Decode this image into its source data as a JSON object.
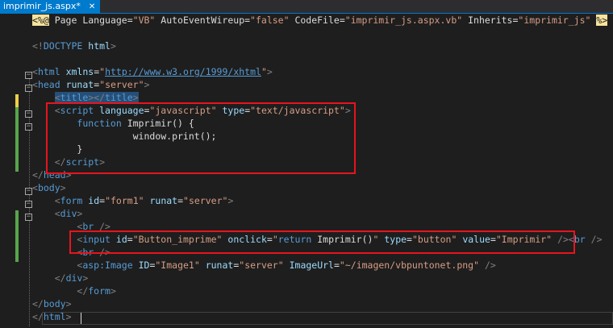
{
  "tab": {
    "title": "imprimir_js.aspx*",
    "close": "✕"
  },
  "lines": [
    {
      "id": "l1",
      "tokens": [
        {
          "c": "dir",
          "t": "<%@"
        },
        {
          "c": "text",
          "t": " Page Language="
        },
        {
          "c": "str",
          "t": "\"VB\""
        },
        {
          "c": "text",
          "t": " AutoEventWireup="
        },
        {
          "c": "str",
          "t": "\"false\""
        },
        {
          "c": "text",
          "t": " CodeFile="
        },
        {
          "c": "str",
          "t": "\"imprimir_js.aspx.vb\""
        },
        {
          "c": "text",
          "t": " Inherits="
        },
        {
          "c": "str",
          "t": "\"imprimir_js\""
        },
        {
          "c": "text",
          "t": " "
        },
        {
          "c": "dir",
          "t": "%>"
        }
      ]
    },
    {
      "id": "l2",
      "tokens": []
    },
    {
      "id": "l3",
      "tokens": [
        {
          "c": "bracket",
          "t": "<!"
        },
        {
          "c": "doctype",
          "t": "DOCTYPE"
        },
        {
          "c": "text",
          "t": " "
        },
        {
          "c": "attr",
          "t": "html"
        },
        {
          "c": "bracket",
          "t": ">"
        }
      ]
    },
    {
      "id": "l4",
      "tokens": []
    },
    {
      "id": "l5",
      "tokens": [
        {
          "c": "bracket",
          "t": "<"
        },
        {
          "c": "tag",
          "t": "html"
        },
        {
          "c": "text",
          "t": " "
        },
        {
          "c": "attr",
          "t": "xmlns"
        },
        {
          "c": "text",
          "t": "="
        },
        {
          "c": "str",
          "t": "\""
        },
        {
          "c": "url",
          "t": "http://www.w3.org/1999/xhtml"
        },
        {
          "c": "str",
          "t": "\""
        },
        {
          "c": "bracket",
          "t": ">"
        }
      ]
    },
    {
      "id": "l6",
      "tokens": [
        {
          "c": "bracket",
          "t": "<"
        },
        {
          "c": "tag",
          "t": "head"
        },
        {
          "c": "text",
          "t": " "
        },
        {
          "c": "attr",
          "t": "runat"
        },
        {
          "c": "text",
          "t": "="
        },
        {
          "c": "str",
          "t": "\"server\""
        },
        {
          "c": "bracket",
          "t": ">"
        }
      ]
    },
    {
      "id": "l7",
      "tokens": [
        {
          "c": "text",
          "t": "    "
        },
        {
          "c": "bracket sel",
          "t": "<"
        },
        {
          "c": "tag sel",
          "t": "title"
        },
        {
          "c": "bracket sel",
          "t": "></"
        },
        {
          "c": "tag sel",
          "t": "title"
        },
        {
          "c": "bracket sel",
          "t": ">"
        }
      ]
    },
    {
      "id": "l8",
      "tokens": [
        {
          "c": "text",
          "t": "    "
        },
        {
          "c": "bracket",
          "t": "<"
        },
        {
          "c": "tag",
          "t": "script"
        },
        {
          "c": "text",
          "t": " "
        },
        {
          "c": "attr",
          "t": "language"
        },
        {
          "c": "text",
          "t": "="
        },
        {
          "c": "str",
          "t": "\"javascript\""
        },
        {
          "c": "text",
          "t": " "
        },
        {
          "c": "attr",
          "t": "type"
        },
        {
          "c": "text",
          "t": "="
        },
        {
          "c": "str",
          "t": "\"text/javascript\""
        },
        {
          "c": "bracket",
          "t": ">"
        }
      ]
    },
    {
      "id": "l9",
      "tokens": [
        {
          "c": "text",
          "t": "        "
        },
        {
          "c": "kw",
          "t": "function"
        },
        {
          "c": "fn",
          "t": " Imprimir() {"
        }
      ]
    },
    {
      "id": "l10",
      "tokens": [
        {
          "c": "text",
          "t": "                  window.print();"
        }
      ]
    },
    {
      "id": "l11",
      "tokens": [
        {
          "c": "text",
          "t": "        }"
        }
      ]
    },
    {
      "id": "l12",
      "tokens": [
        {
          "c": "text",
          "t": "    "
        },
        {
          "c": "bracket",
          "t": "</"
        },
        {
          "c": "tag",
          "t": "script"
        },
        {
          "c": "bracket",
          "t": ">"
        }
      ]
    },
    {
      "id": "l13",
      "tokens": [
        {
          "c": "bracket",
          "t": "</"
        },
        {
          "c": "tag",
          "t": "head"
        },
        {
          "c": "bracket",
          "t": ">"
        }
      ]
    },
    {
      "id": "l14",
      "tokens": [
        {
          "c": "bracket",
          "t": "<"
        },
        {
          "c": "tag",
          "t": "body"
        },
        {
          "c": "bracket",
          "t": ">"
        }
      ]
    },
    {
      "id": "l15",
      "tokens": [
        {
          "c": "text",
          "t": "    "
        },
        {
          "c": "bracket",
          "t": "<"
        },
        {
          "c": "tag",
          "t": "form"
        },
        {
          "c": "text",
          "t": " "
        },
        {
          "c": "attr",
          "t": "id"
        },
        {
          "c": "text",
          "t": "="
        },
        {
          "c": "str",
          "t": "\"form1\""
        },
        {
          "c": "text",
          "t": " "
        },
        {
          "c": "attr",
          "t": "runat"
        },
        {
          "c": "text",
          "t": "="
        },
        {
          "c": "str",
          "t": "\"server\""
        },
        {
          "c": "bracket",
          "t": ">"
        }
      ]
    },
    {
      "id": "l16",
      "tokens": [
        {
          "c": "text",
          "t": "    "
        },
        {
          "c": "bracket",
          "t": "<"
        },
        {
          "c": "tag",
          "t": "div"
        },
        {
          "c": "bracket",
          "t": ">"
        }
      ]
    },
    {
      "id": "l17",
      "tokens": [
        {
          "c": "text",
          "t": "        "
        },
        {
          "c": "bracket",
          "t": "<"
        },
        {
          "c": "tag",
          "t": "br"
        },
        {
          "c": "text",
          "t": " "
        },
        {
          "c": "bracket",
          "t": "/>"
        }
      ]
    },
    {
      "id": "l18",
      "tokens": [
        {
          "c": "text",
          "t": "        "
        },
        {
          "c": "bracket",
          "t": "<"
        },
        {
          "c": "tag",
          "t": "input"
        },
        {
          "c": "text",
          "t": " "
        },
        {
          "c": "attr",
          "t": "id"
        },
        {
          "c": "text",
          "t": "="
        },
        {
          "c": "str",
          "t": "\"Button_imprime\""
        },
        {
          "c": "text",
          "t": " "
        },
        {
          "c": "attr",
          "t": "onclick"
        },
        {
          "c": "text",
          "t": "="
        },
        {
          "c": "str",
          "t": "\""
        },
        {
          "c": "kw",
          "t": "return"
        },
        {
          "c": "text",
          "t": " Imprimir()"
        },
        {
          "c": "str",
          "t": "\""
        },
        {
          "c": "text",
          "t": " "
        },
        {
          "c": "attr",
          "t": "type"
        },
        {
          "c": "text",
          "t": "="
        },
        {
          "c": "str",
          "t": "\"button\""
        },
        {
          "c": "text",
          "t": " "
        },
        {
          "c": "attr",
          "t": "value"
        },
        {
          "c": "text",
          "t": "="
        },
        {
          "c": "str",
          "t": "\"Imprimir\""
        },
        {
          "c": "text",
          "t": " "
        },
        {
          "c": "bracket",
          "t": "/>"
        },
        {
          "c": "bracket",
          "t": "<"
        },
        {
          "c": "tag",
          "t": "br"
        },
        {
          "c": "text",
          "t": " "
        },
        {
          "c": "bracket",
          "t": "/>"
        }
      ]
    },
    {
      "id": "l19",
      "tokens": [
        {
          "c": "text",
          "t": "        "
        },
        {
          "c": "bracket",
          "t": "<"
        },
        {
          "c": "tag",
          "t": "br"
        },
        {
          "c": "text",
          "t": " "
        },
        {
          "c": "bracket",
          "t": "/>"
        }
      ]
    },
    {
      "id": "l20",
      "tokens": [
        {
          "c": "text",
          "t": "        "
        },
        {
          "c": "bracket",
          "t": "<"
        },
        {
          "c": "tag",
          "t": "asp:Image"
        },
        {
          "c": "text",
          "t": " "
        },
        {
          "c": "attr",
          "t": "ID"
        },
        {
          "c": "text",
          "t": "="
        },
        {
          "c": "str",
          "t": "\"Image1\""
        },
        {
          "c": "text",
          "t": " "
        },
        {
          "c": "attr",
          "t": "runat"
        },
        {
          "c": "text",
          "t": "="
        },
        {
          "c": "str",
          "t": "\"server\""
        },
        {
          "c": "text",
          "t": " "
        },
        {
          "c": "attr",
          "t": "ImageUrl"
        },
        {
          "c": "text",
          "t": "="
        },
        {
          "c": "str",
          "t": "\"~/imagen/vbpuntonet.png\""
        },
        {
          "c": "text",
          "t": " "
        },
        {
          "c": "bracket",
          "t": "/>"
        }
      ]
    },
    {
      "id": "l21",
      "tokens": [
        {
          "c": "text",
          "t": "    "
        },
        {
          "c": "bracket",
          "t": "</"
        },
        {
          "c": "tag",
          "t": "div"
        },
        {
          "c": "bracket",
          "t": ">"
        }
      ]
    },
    {
      "id": "l22",
      "tokens": [
        {
          "c": "text",
          "t": "        "
        },
        {
          "c": "bracket",
          "t": "</"
        },
        {
          "c": "tag",
          "t": "form"
        },
        {
          "c": "bracket",
          "t": ">"
        }
      ]
    },
    {
      "id": "l23",
      "tokens": [
        {
          "c": "bracket",
          "t": "</"
        },
        {
          "c": "tag",
          "t": "body"
        },
        {
          "c": "bracket",
          "t": ">"
        }
      ]
    },
    {
      "id": "l24",
      "tokens": [
        {
          "c": "bracket",
          "t": "</"
        },
        {
          "c": "tag",
          "t": "html"
        },
        {
          "c": "bracket",
          "t": ">"
        }
      ]
    }
  ],
  "colors": {
    "background": "#1e1e1e",
    "accent": "#007acc",
    "highlight_box": "#e8141c",
    "change_marker": "#57a64a",
    "unsaved_marker": "#efce4a"
  },
  "fold_glyph": "−"
}
